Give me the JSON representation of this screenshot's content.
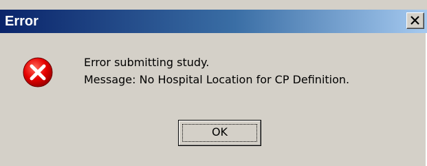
{
  "window": {
    "title": "Error",
    "close_icon": "close-icon"
  },
  "content": {
    "icon": "error-icon",
    "line1": "Error submitting study.",
    "line2": "Message: No Hospital Location for CP Definition."
  },
  "buttons": {
    "ok_label": "OK"
  },
  "colors": {
    "title_start": "#0a246a",
    "title_end": "#a6caf0",
    "dialog_bg": "#d4d0c8",
    "error_red": "#e60000"
  }
}
